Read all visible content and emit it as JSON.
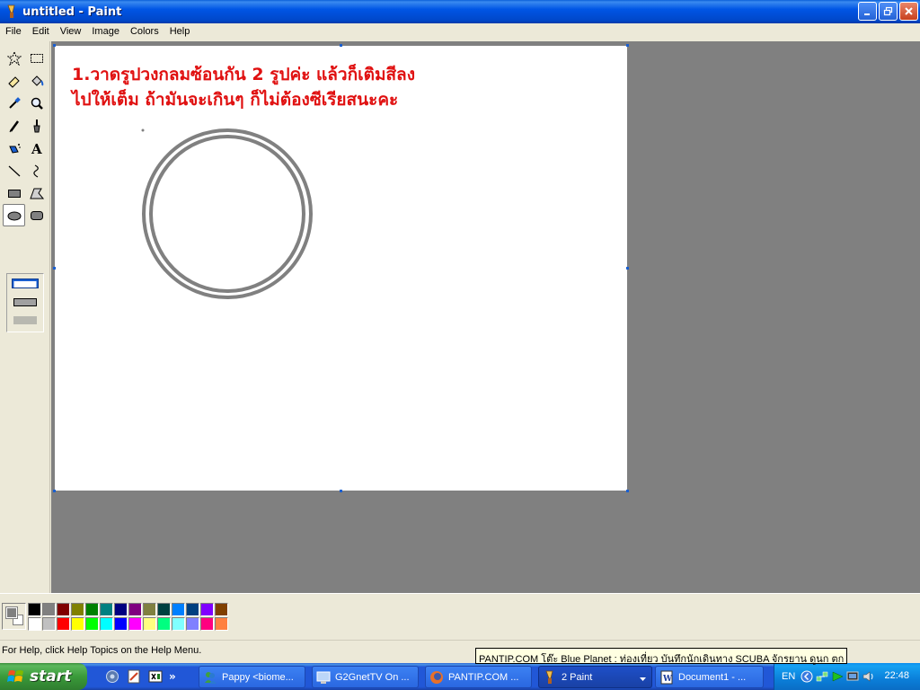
{
  "window": {
    "title": "untitled - Paint",
    "app_icon": "paint-icon"
  },
  "menu": [
    "File",
    "Edit",
    "View",
    "Image",
    "Colors",
    "Help"
  ],
  "tools": [
    {
      "name": "free-form-select-tool",
      "icon": "star-select-icon"
    },
    {
      "name": "select-tool",
      "icon": "rect-select-icon"
    },
    {
      "name": "eraser-tool",
      "icon": "eraser-icon"
    },
    {
      "name": "fill-tool",
      "icon": "bucket-icon"
    },
    {
      "name": "pick-color-tool",
      "icon": "eyedropper-icon"
    },
    {
      "name": "magnifier-tool",
      "icon": "magnifier-icon"
    },
    {
      "name": "pencil-tool",
      "icon": "pencil-icon"
    },
    {
      "name": "brush-tool",
      "icon": "brush-icon"
    },
    {
      "name": "airbrush-tool",
      "icon": "airbrush-icon"
    },
    {
      "name": "text-tool",
      "icon": "text-a-icon"
    },
    {
      "name": "line-tool",
      "icon": "line-icon"
    },
    {
      "name": "curve-tool",
      "icon": "curve-icon"
    },
    {
      "name": "rectangle-tool",
      "icon": "rectangle-icon"
    },
    {
      "name": "polygon-tool",
      "icon": "polygon-icon"
    },
    {
      "name": "ellipse-tool",
      "icon": "ellipse-icon",
      "active": true
    },
    {
      "name": "rounded-rectangle-tool",
      "icon": "rounded-rect-icon"
    }
  ],
  "canvas": {
    "line1_number": "1.",
    "line1_text": "วาดรูปวงกลมซ้อนกัน 2  รูปค่ะ แล้วก็เติมสีลง",
    "line2_text": "ไปให้เต็ม ถ้ามันจะเกินๆ ก็ไม่ต้องซีเรียสนะคะ",
    "text_color": "#e01010",
    "circle_color": "#808080"
  },
  "palette": {
    "foreground": "#808080",
    "background": "#ffffff",
    "colors": [
      "#000000",
      "#808080",
      "#800000",
      "#808000",
      "#008000",
      "#008080",
      "#000080",
      "#800080",
      "#808040",
      "#004040",
      "#0080ff",
      "#004080",
      "#8000ff",
      "#804000",
      "#ffffff",
      "#c0c0c0",
      "#ff0000",
      "#ffff00",
      "#00ff00",
      "#00ffff",
      "#0000ff",
      "#ff00ff",
      "#ffff80",
      "#00ff80",
      "#80ffff",
      "#8080ff",
      "#ff0080",
      "#ff8040"
    ]
  },
  "status": {
    "help_text": "For Help, click Help Topics on the Help Menu."
  },
  "tooltip": {
    "text": "PANTIP.COM โต๊ะ Blue Planet : ท่องเที่ยว บันทึกนักเดินทาง SCUBA จักรยาน ดูนก ตก"
  },
  "taskbar": {
    "start_label": "start",
    "quicklaunch_icons": [
      "browser-icon",
      "notepad-icon",
      "excel-icon"
    ],
    "quicklaunch_more": "»",
    "tasks": [
      {
        "label": "Pappy <biome...",
        "icon": "messenger-icon"
      },
      {
        "label": "G2GnetTV On ...",
        "icon": "monitor-icon"
      },
      {
        "label": "PANTIP.COM ...",
        "icon": "firefox-icon"
      },
      {
        "label": "2 Paint",
        "icon": "paint-icon",
        "active": true
      },
      {
        "label": "Document1 - ...",
        "icon": "word-icon"
      }
    ],
    "tray": {
      "language": "EN",
      "icons": [
        "back-arrow-icon",
        "network-icon",
        "play-icon",
        "monitor-tray-icon",
        "speaker-icon"
      ],
      "clock": "22:48"
    }
  }
}
